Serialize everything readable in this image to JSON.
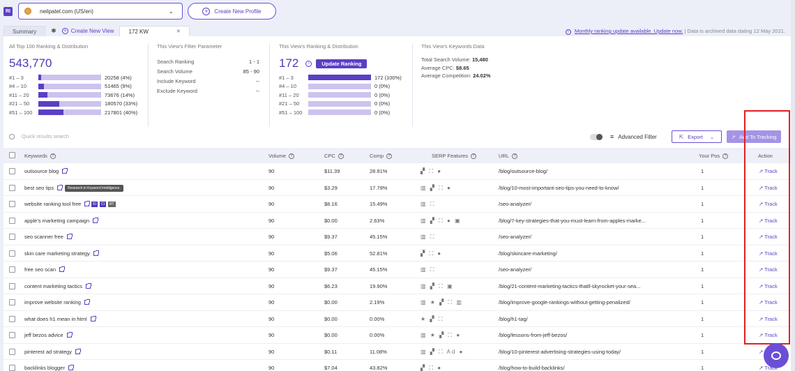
{
  "logo": "RI",
  "domain": {
    "value": "neilpatel.com (US/en)"
  },
  "create_profile": "Create New Profile",
  "tabs": {
    "summary": "Summary",
    "create_view": "Create New View",
    "kw": "172 KW"
  },
  "notice": {
    "link": "Monthly ranking update available. Update now.",
    "rest": "|  Data is archived data dating 12 May 2021."
  },
  "all_top": {
    "title": "All Top 100 Ranking & Distribution",
    "total": "543,770",
    "rows": [
      {
        "label": "#1 – 3",
        "value": "20258 (4%)",
        "pct": 4
      },
      {
        "label": "#4 – 10",
        "value": "51465 (9%)",
        "pct": 9
      },
      {
        "label": "#11 – 20",
        "value": "73676 (14%)",
        "pct": 14
      },
      {
        "label": "#21 – 50",
        "value": "180570 (33%)",
        "pct": 33
      },
      {
        "label": "#51 – 100",
        "value": "217801 (40%)",
        "pct": 40
      }
    ]
  },
  "filter": {
    "title": "This View's Filter Parameter",
    "rows": [
      {
        "k": "Search Ranking",
        "v": "1 - 1"
      },
      {
        "k": "Search Volume",
        "v": "85 - 90"
      },
      {
        "k": "Include Keyword",
        "v": "--"
      },
      {
        "k": "Exclude Keyword",
        "v": "--"
      }
    ]
  },
  "view_rank": {
    "title": "This View's Ranking & Distribution",
    "total": "172",
    "update_button": "Update Ranking",
    "rows": [
      {
        "label": "#1 – 3",
        "value": "172 (100%)",
        "pct": 100
      },
      {
        "label": "#4 – 10",
        "value": "0 (0%)",
        "pct": 0
      },
      {
        "label": "#11 – 20",
        "value": "0 (0%)",
        "pct": 0
      },
      {
        "label": "#21 – 50",
        "value": "0 (0%)",
        "pct": 0
      },
      {
        "label": "#51 – 100",
        "value": "0 (0%)",
        "pct": 0
      }
    ]
  },
  "kw_data": {
    "title": "This View's Keywords Data",
    "lines": [
      {
        "k": "Total Search Volume:",
        "v": "15,480"
      },
      {
        "k": "Average CPC:",
        "v": "$8.65"
      },
      {
        "k": "Average Competition:",
        "v": "24.02%"
      }
    ]
  },
  "toolbar": {
    "search_placeholder": "Quick results search",
    "advanced": "Advanced Filter",
    "export": "Export",
    "add_tracking": "Add To Tracking"
  },
  "columns": {
    "keywords": "Keywords",
    "volume": "Volume",
    "cpc": "CPC",
    "comp": "Comp",
    "serp": "SERP Features",
    "url": "URL",
    "pos": "Your Pos",
    "action": "Action"
  },
  "tooltip": "Research in Keyword Intelligence.",
  "rows": [
    {
      "kw": "outsource blog",
      "vol": "90",
      "cpc": "$11.39",
      "comp": "28.91%",
      "serp": "▞ ⛶ ●",
      "url": "/blog/outsource-blog/",
      "pos": "1",
      "action": "Track"
    },
    {
      "kw": "best seo tips",
      "vol": "90",
      "cpc": "$3.29",
      "comp": "17.79%",
      "serp": "▥ ▞ ⛶ ●",
      "url": "/blog/10-most-important-seo-tips-you-need-to-know/",
      "pos": "1",
      "action": "Track"
    },
    {
      "kw": "website ranking tool free",
      "vol": "90",
      "cpc": "$8.16",
      "comp": "15.49%",
      "serp": "▥ ⛶",
      "url": "/seo-analyzer/",
      "pos": "1",
      "action": "Track"
    },
    {
      "kw": "apple's marketing campaign",
      "vol": "90",
      "cpc": "$0.00",
      "comp": "2.63%",
      "serp": "▥ ▞ ⛶ ● ▣",
      "url": "/blog/7-key-strategies-that-you-must-learn-from-apples-marke...",
      "pos": "1",
      "action": "Track"
    },
    {
      "kw": "seo scanner free",
      "vol": "90",
      "cpc": "$9.37",
      "comp": "45.15%",
      "serp": "▥ ⛶",
      "url": "/seo-analyzer/",
      "pos": "1",
      "action": "Track"
    },
    {
      "kw": "skin care marketing strategy",
      "vol": "90",
      "cpc": "$5.06",
      "comp": "52.81%",
      "serp": "▞ ⛶ ●",
      "url": "/blog/skincare-marketing/",
      "pos": "1",
      "action": "Track"
    },
    {
      "kw": "free seo scan",
      "vol": "90",
      "cpc": "$9.37",
      "comp": "45.15%",
      "serp": "▥ ⛶",
      "url": "/seo-analyzer/",
      "pos": "1",
      "action": "Track"
    },
    {
      "kw": "content marketing tactics",
      "vol": "90",
      "cpc": "$6.23",
      "comp": "19.90%",
      "serp": "▥ ▞ ⛶ ▣",
      "url": "/blog/21-content-marketing-tactics-thatll-skyrocket-your-sea...",
      "pos": "1",
      "action": "Track"
    },
    {
      "kw": "improve website ranking",
      "vol": "90",
      "cpc": "$0.00",
      "comp": "2.19%",
      "serp": "▥ ★ ▞ ⛶ ▥",
      "url": "/blog/improve-google-rankings-without-getting-penalized/",
      "pos": "1",
      "action": "Track"
    },
    {
      "kw": "what does h1 mean in html",
      "vol": "90",
      "cpc": "$0.00",
      "comp": "0.00%",
      "serp": "★ ▞ ⛶",
      "url": "/blog/h1-tag/",
      "pos": "1",
      "action": "Track"
    },
    {
      "kw": "jeff bezos advice",
      "vol": "90",
      "cpc": "$0.00",
      "comp": "0.00%",
      "serp": "▥ ★ ▞ ⛶ ●",
      "url": "/blog/lessons-from-jeff-bezos/",
      "pos": "1",
      "action": "Track"
    },
    {
      "kw": "pinterest ad strategy",
      "vol": "90",
      "cpc": "$0.11",
      "comp": "11.08%",
      "serp": "▥ ▞ ⛶ Ad ●",
      "url": "/blog/10-pinterest-advertising-strategies-using-today/",
      "pos": "1",
      "action": "Track"
    },
    {
      "kw": "backlinks blogger",
      "vol": "90",
      "cpc": "$7.04",
      "comp": "43.82%",
      "serp": "▞ ⛶ ●",
      "url": "/blog/how-to-build-backlinks/",
      "pos": "1",
      "action": "Track"
    }
  ]
}
